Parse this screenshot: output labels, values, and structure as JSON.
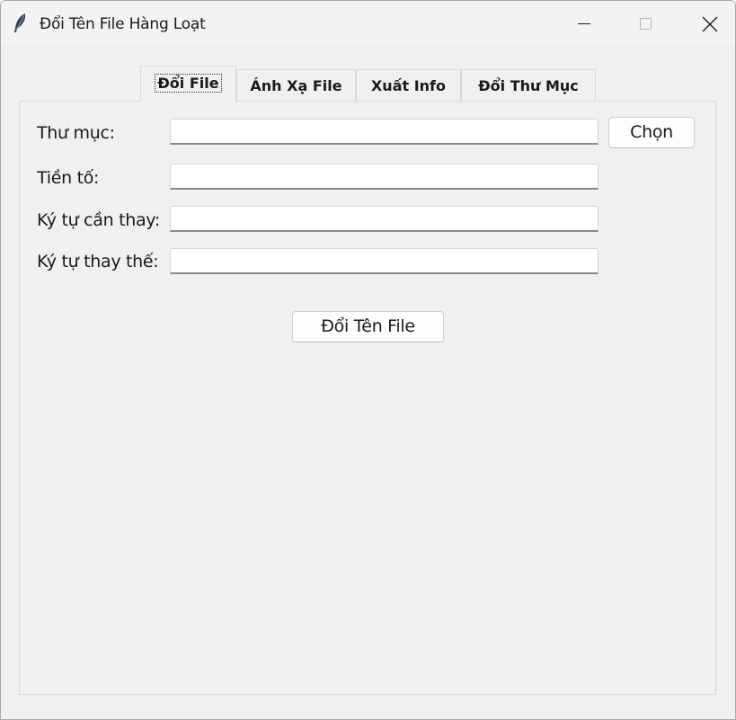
{
  "window": {
    "title": "Đổi Tên File Hàng Loạt",
    "app_icon": "feather-icon",
    "controls": [
      "minimize-icon",
      "maximize-icon",
      "close-icon"
    ]
  },
  "tabs": [
    {
      "label": "Đổi File",
      "selected": true
    },
    {
      "label": "Ánh Xạ File",
      "selected": false
    },
    {
      "label": "Xuất Info",
      "selected": false
    },
    {
      "label": "Đổi Thư Mục",
      "selected": false
    }
  ],
  "form": {
    "folder": {
      "label": "Thư mục:",
      "value": "",
      "button": "Chọn"
    },
    "prefix": {
      "label": "Tiền tố:",
      "value": ""
    },
    "find": {
      "label": "Ký tự cần thay:",
      "value": ""
    },
    "replace": {
      "label": "Ký tự thay thế:",
      "value": ""
    }
  },
  "actions": {
    "rename_label": "Đổi Tên File"
  }
}
